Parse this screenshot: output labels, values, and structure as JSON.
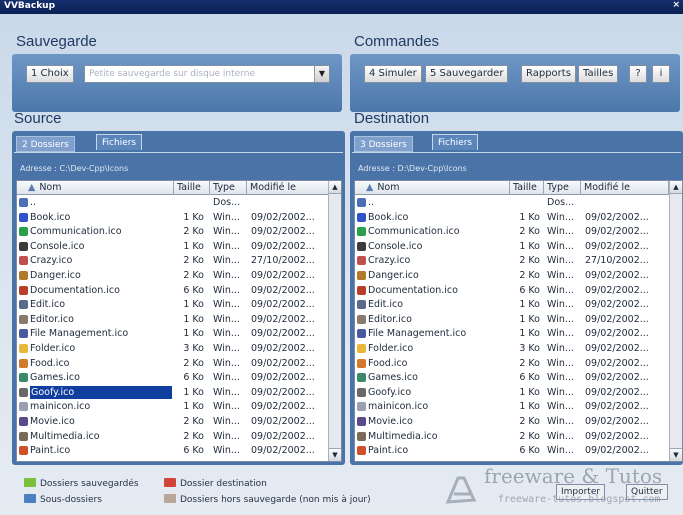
{
  "window": {
    "title": "VVBackup"
  },
  "sauvegarde": {
    "title": "Sauvegarde",
    "choice_button": "1 Choix",
    "combo_value": "Petite sauvegarde sur disque interne"
  },
  "commandes": {
    "title": "Commandes",
    "buttons": [
      "4 Simuler",
      "5 Sauvegarder",
      "Rapports",
      "Tailles",
      "?",
      "i"
    ]
  },
  "columns": [
    "Nom",
    "Taille",
    "Type",
    "Modifié le"
  ],
  "source": {
    "title": "Source",
    "tabs": [
      "2 Dossiers",
      "Fichiers"
    ],
    "address": "Adresse : C:\\Dev-Cpp\\Icons",
    "selected": "Goofy.ico"
  },
  "destination": {
    "title": "Destination",
    "tabs": [
      "3 Dossiers",
      "Fichiers"
    ],
    "address": "Adresse : D:\\Dev-Cpp\\Icons"
  },
  "files": [
    {
      "name": "..",
      "size": "",
      "type": "Dos...",
      "date": "",
      "color": "#4a6fb5"
    },
    {
      "name": "Book.ico",
      "size": "1 Ko",
      "type": "Win...",
      "date": "09/02/2002...",
      "color": "#2f54c8"
    },
    {
      "name": "Communication.ico",
      "size": "2 Ko",
      "type": "Win...",
      "date": "09/02/2002...",
      "color": "#2aa04a"
    },
    {
      "name": "Console.ico",
      "size": "1 Ko",
      "type": "Win...",
      "date": "09/02/2002...",
      "color": "#3b3b3b"
    },
    {
      "name": "Crazy.ico",
      "size": "2 Ko",
      "type": "Win...",
      "date": "27/10/2002...",
      "color": "#c05050"
    },
    {
      "name": "Danger.ico",
      "size": "2 Ko",
      "type": "Win...",
      "date": "09/02/2002...",
      "color": "#b07a2a"
    },
    {
      "name": "Documentation.ico",
      "size": "6 Ko",
      "type": "Win...",
      "date": "09/02/2002...",
      "color": "#b8402a"
    },
    {
      "name": "Edit.ico",
      "size": "1 Ko",
      "type": "Win...",
      "date": "09/02/2002...",
      "color": "#5a6a8a"
    },
    {
      "name": "Editor.ico",
      "size": "1 Ko",
      "type": "Win...",
      "date": "09/02/2002...",
      "color": "#8a7a6a"
    },
    {
      "name": "File Management.ico",
      "size": "1 Ko",
      "type": "Win...",
      "date": "09/02/2002...",
      "color": "#4a5aa0"
    },
    {
      "name": "Folder.ico",
      "size": "3 Ko",
      "type": "Win...",
      "date": "09/02/2002...",
      "color": "#e8b83a"
    },
    {
      "name": "Food.ico",
      "size": "2 Ko",
      "type": "Win...",
      "date": "09/02/2002...",
      "color": "#d07a2a"
    },
    {
      "name": "Games.ico",
      "size": "6 Ko",
      "type": "Win...",
      "date": "09/02/2002...",
      "color": "#3a8a6a"
    },
    {
      "name": "Goofy.ico",
      "size": "1 Ko",
      "type": "Win...",
      "date": "09/02/2002...",
      "color": "#6a6a6a"
    },
    {
      "name": "mainicon.ico",
      "size": "1 Ko",
      "type": "Win...",
      "date": "09/02/2002...",
      "color": "#9aa0b0"
    },
    {
      "name": "Movie.ico",
      "size": "2 Ko",
      "type": "Win...",
      "date": "09/02/2002...",
      "color": "#5a4a8a"
    },
    {
      "name": "Multimedia.ico",
      "size": "2 Ko",
      "type": "Win...",
      "date": "09/02/2002...",
      "color": "#7a6a5a"
    },
    {
      "name": "Paint.ico",
      "size": "6 Ko",
      "type": "Win...",
      "date": "09/02/2002...",
      "color": "#d0502a"
    }
  ],
  "legend": [
    {
      "label": "Dossiers sauvegardés",
      "color": "#7cbf3a"
    },
    {
      "label": "Sous-dossiers",
      "color": "#4a7fc0"
    },
    {
      "label": "Dossier destination",
      "color": "#d0443a"
    },
    {
      "label": "Dossiers hors sauvegarde (non mis à jour)",
      "color": "#b8a898"
    }
  ],
  "footer": {
    "importer": "Importer",
    "quitter": "Quitter"
  },
  "watermark": {
    "brand": "freeware & Tutos",
    "url": "freeware-tutos.blogspot.com"
  }
}
